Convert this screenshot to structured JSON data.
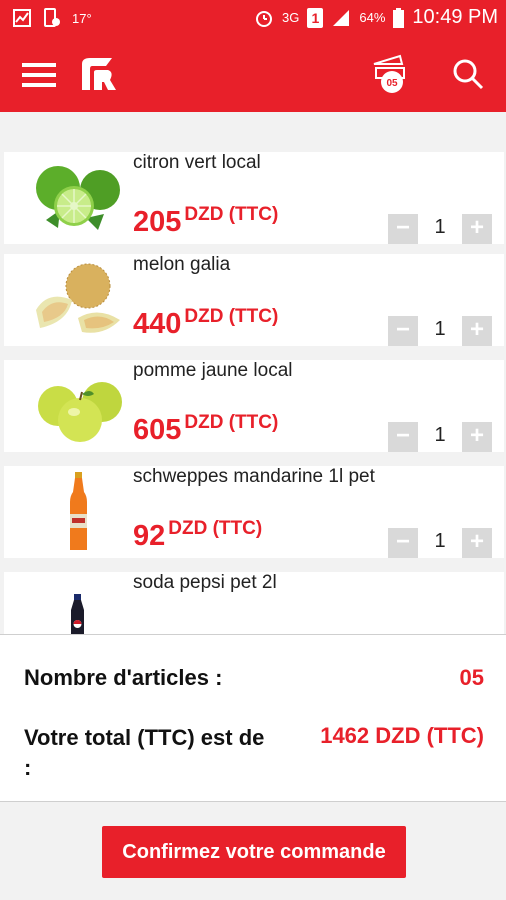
{
  "status_bar": {
    "temperature": "17°",
    "network": "3G",
    "sim": "1",
    "battery": "64%",
    "time": "10:49 PM"
  },
  "app_bar": {
    "promo_badge": "05"
  },
  "products": [
    {
      "name": "citron vert local",
      "price": "205",
      "currency": "DZD (TTC)",
      "quantity": "1",
      "minus": "−",
      "plus": "+"
    },
    {
      "name": "melon galia",
      "price": "440",
      "currency": "DZD (TTC)",
      "quantity": "1",
      "minus": "−",
      "plus": "+"
    },
    {
      "name": "pomme jaune local",
      "price": "605",
      "currency": "DZD (TTC)",
      "quantity": "1",
      "minus": "−",
      "plus": "+"
    },
    {
      "name": "schweppes mandarine 1l pet",
      "price": "92",
      "currency": "DZD (TTC)",
      "quantity": "1",
      "minus": "−",
      "plus": "+"
    },
    {
      "name": "soda pepsi  pet 2l",
      "price": "",
      "currency": "",
      "quantity": "",
      "minus": "",
      "plus": ""
    }
  ],
  "summary": {
    "count_label": "Nombre d'articles :",
    "count_value": "05",
    "total_label": "Votre total (TTC) est de :",
    "total_value": "1462 DZD (TTC)"
  },
  "confirm_label": "Confirmez votre commande",
  "colors": {
    "primary": "#e8202a",
    "qty_button": "#d9d9d9"
  }
}
